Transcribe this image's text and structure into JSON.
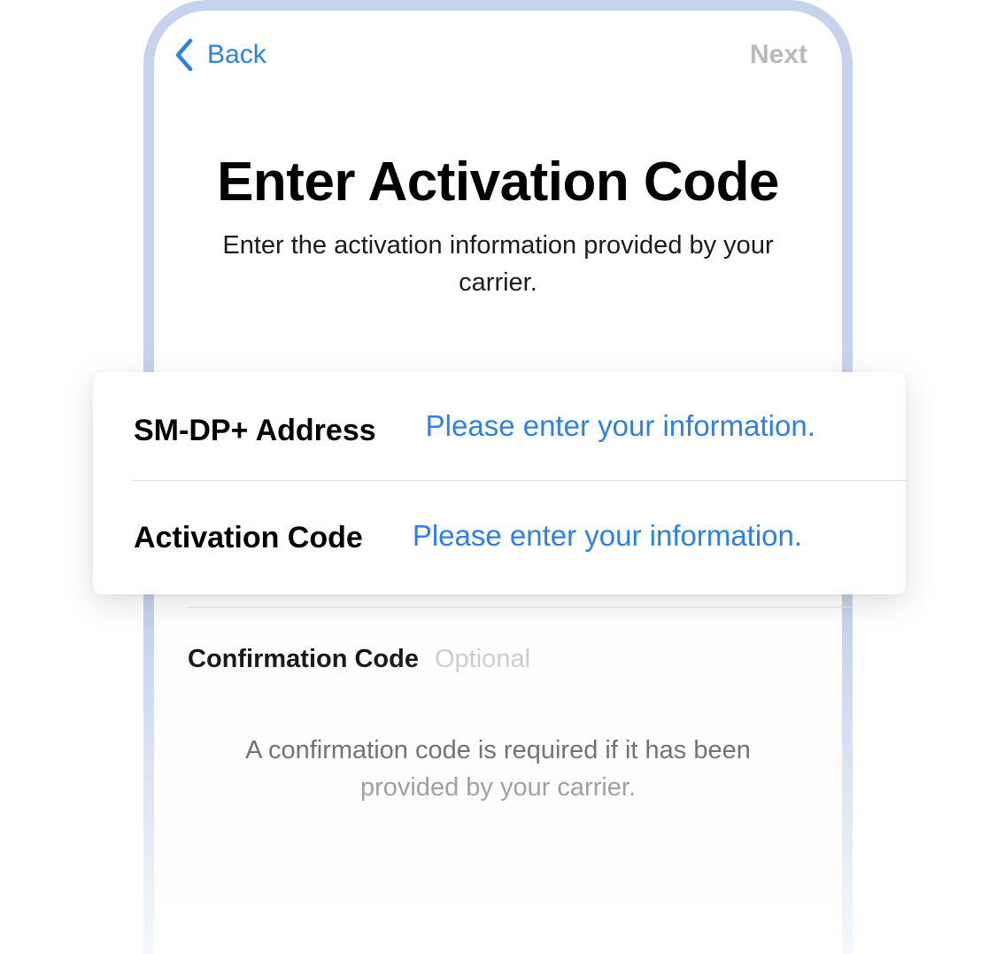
{
  "nav": {
    "back_label": "Back",
    "next_label": "Next"
  },
  "header": {
    "title": "Enter Activation Code",
    "subtitle": "Enter the activation information provided by your carrier."
  },
  "card": {
    "rows": [
      {
        "label": "SM-DP+ Address",
        "placeholder": "Please enter your information."
      },
      {
        "label": "Activation Code",
        "placeholder": "Please enter your information."
      }
    ]
  },
  "confirmation": {
    "label": "Confirmation Code",
    "placeholder": "Optional",
    "note_line1": "A confirmation code is required if it has been",
    "note_line2": "provided by your carrier."
  },
  "colors": {
    "accent": "#2f80e6",
    "frame": "#c5d4ec",
    "disabled": "#b9b9bd",
    "placeholder": "#c7c7cc"
  }
}
